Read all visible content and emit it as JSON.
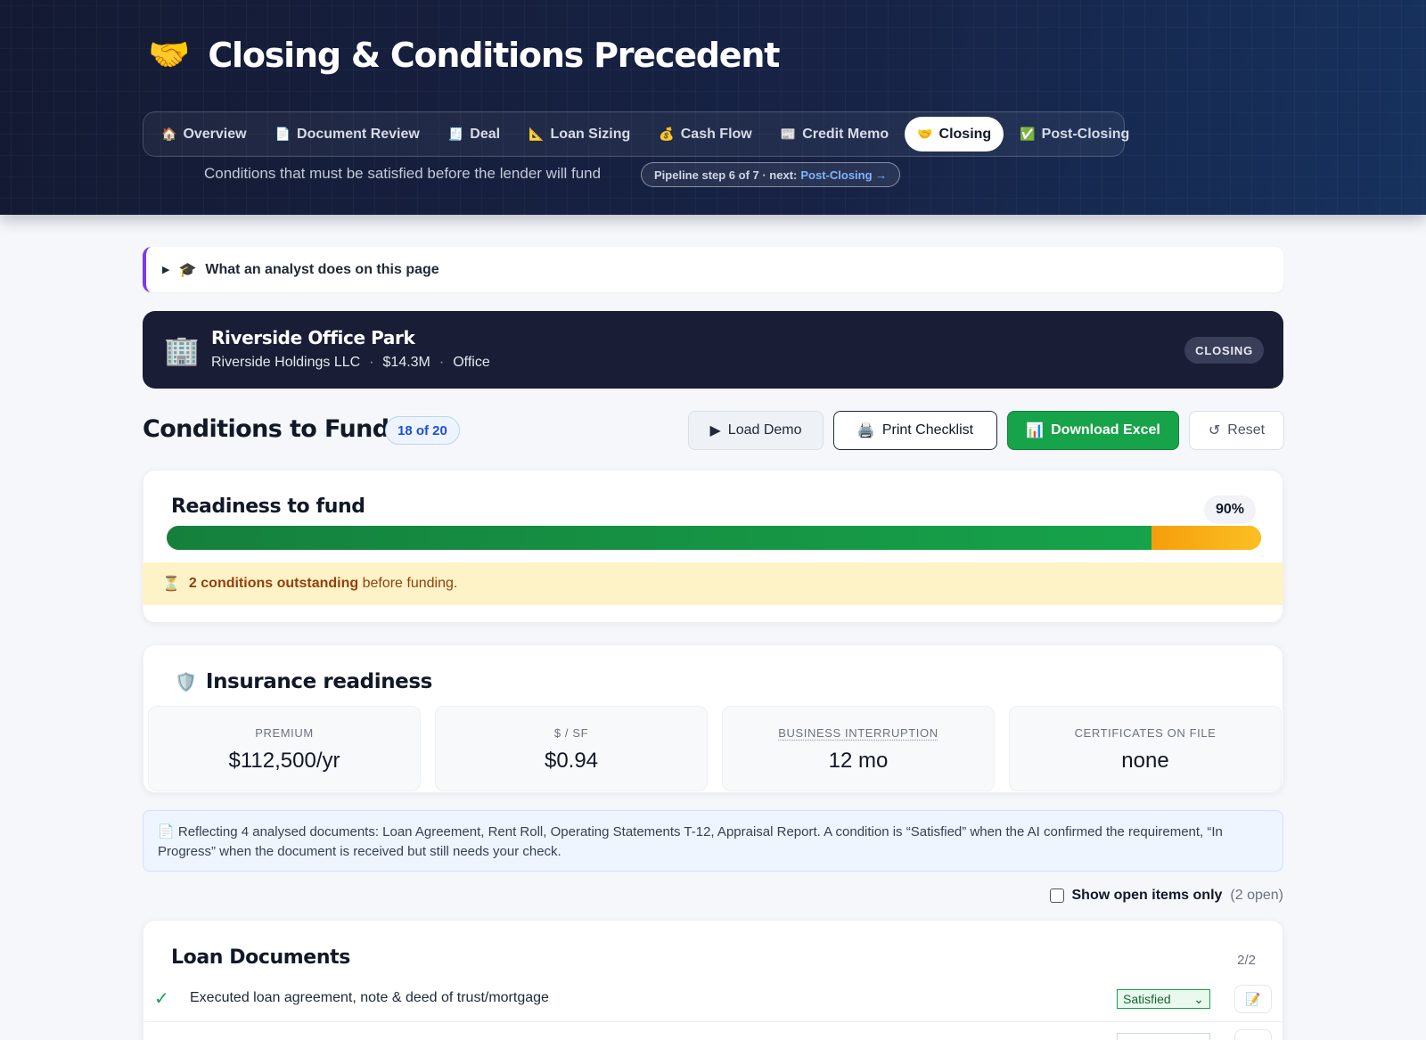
{
  "header": {
    "icon": "🤝",
    "title": "Closing & Conditions Precedent",
    "subtitle": "Conditions that must be satisfied before the lender will fund",
    "pipeline_prefix": "Pipeline step 6 of 7 · next:",
    "pipeline_next": "Post-Closing →"
  },
  "tabs": [
    {
      "icon": "🏠",
      "label": "Overview"
    },
    {
      "icon": "📄",
      "label": "Document Review"
    },
    {
      "icon": "🧾",
      "label": "Deal"
    },
    {
      "icon": "📐",
      "label": "Loan Sizing"
    },
    {
      "icon": "💰",
      "label": "Cash Flow"
    },
    {
      "icon": "📰",
      "label": "Credit Memo"
    },
    {
      "icon": "🤝",
      "label": "Closing",
      "active": true
    },
    {
      "icon": "✅",
      "label": "Post-Closing"
    }
  ],
  "analyst": {
    "toggle": "▶",
    "icon": "🎓",
    "label": "What an analyst does on this page"
  },
  "deal": {
    "icon": "🏢",
    "name": "Riverside Office Park",
    "borrower": "Riverside Holdings LLC",
    "amount": "$14.3M",
    "type": "Office",
    "separator": "·",
    "status": "CLOSING"
  },
  "conditions": {
    "title": "Conditions to Fund",
    "badge": "18 of 20",
    "buttons": {
      "demo_icon": "▶",
      "demo": "Load Demo",
      "print_icon": "🖨️",
      "print": "Print Checklist",
      "excel_icon": "📊",
      "excel": "Download Excel",
      "reset_icon": "↺",
      "reset": "Reset"
    }
  },
  "readiness": {
    "title": "Readiness to fund",
    "percent_label": "90%",
    "percent": 0.9,
    "alert_icon": "⏳",
    "alert_bold": "2 conditions outstanding",
    "alert_rest": " before funding."
  },
  "insurance": {
    "icon": "🛡️",
    "title": "Insurance readiness",
    "tiles": [
      {
        "label": "PREMIUM",
        "value": "$112,500/yr"
      },
      {
        "label": "$ / SF",
        "value": "$0.94"
      },
      {
        "label": "BUSINESS INTERRUPTION",
        "value": "12 mo"
      },
      {
        "label": "CERTIFICATES ON FILE",
        "value": "none"
      }
    ]
  },
  "note": {
    "icon": "📄",
    "text": "Reflecting 4 analysed documents: Loan Agreement, Rent Roll, Operating Statements T-12, Appraisal Report. A condition is “Satisfied” when the AI confirmed the requirement, “In Progress” when the document is received but still needs your check."
  },
  "filter": {
    "label": "Show open items only",
    "count": "(2 open)"
  },
  "loan_documents": {
    "title": "Loan Documents",
    "ratio": "2/2",
    "items": [
      {
        "check": "✓",
        "text": "Executed loan agreement, note & deed of trust/mortgage",
        "status": "Satisfied",
        "chevron": "⌄",
        "file_icon": "📝"
      }
    ]
  },
  "colors": {
    "accent": "#16a34a",
    "warning": "#f59e0b",
    "hero": "#141a33",
    "deal_card": "#191d35",
    "analyst_border": "#7c3aed"
  }
}
